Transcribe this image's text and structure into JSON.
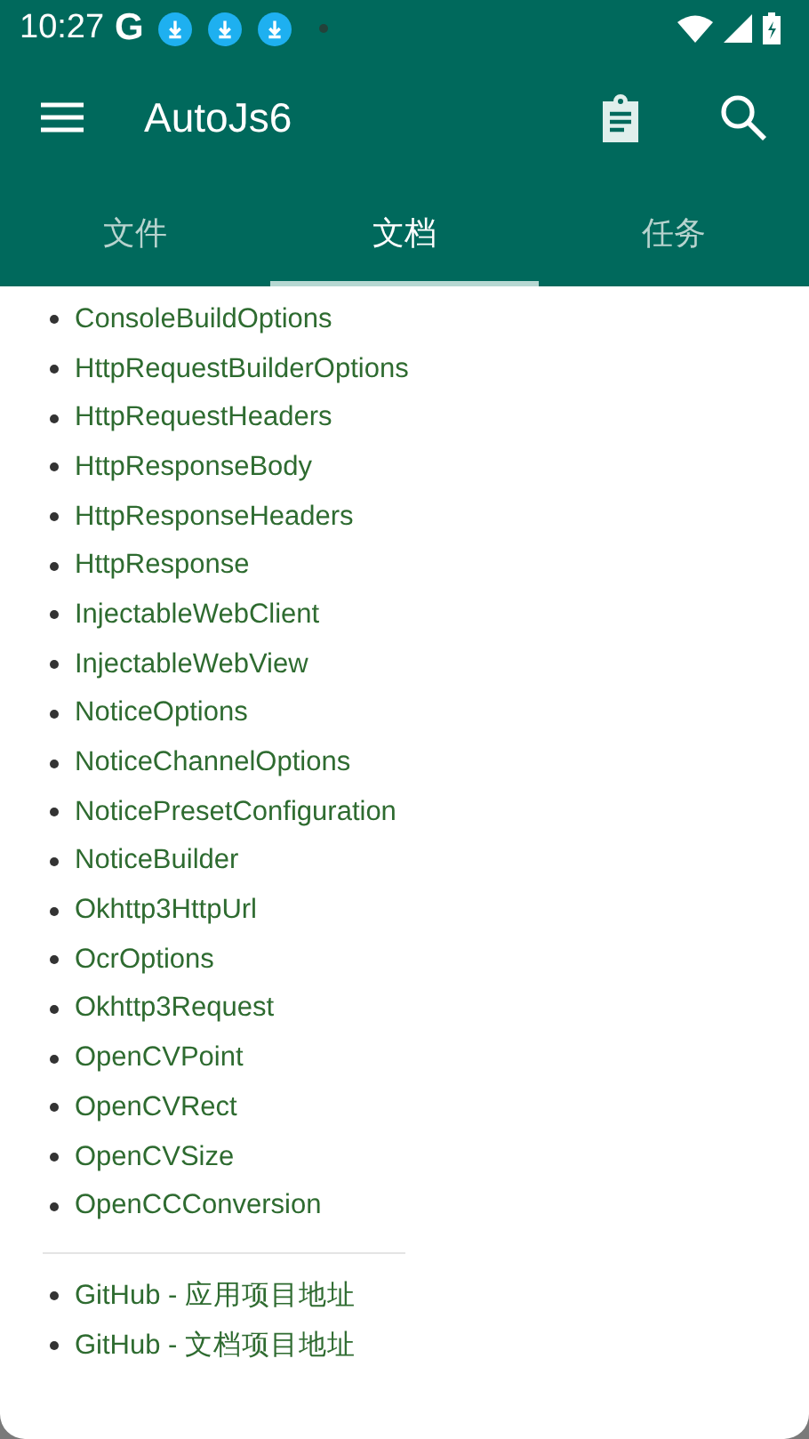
{
  "status_bar": {
    "time": "10:27",
    "carrier_letter": "G"
  },
  "app_bar": {
    "title": "AutoJs6"
  },
  "tabs": [
    {
      "label": "文件",
      "selected": false
    },
    {
      "label": "文档",
      "selected": true
    },
    {
      "label": "任务",
      "selected": false
    }
  ],
  "doc_links": [
    "ConsoleBuildOptions",
    "HttpRequestBuilderOptions",
    "HttpRequestHeaders",
    "HttpResponseBody",
    "HttpResponseHeaders",
    "HttpResponse",
    "InjectableWebClient",
    "InjectableWebView",
    "NoticeOptions",
    "NoticeChannelOptions",
    "NoticePresetConfiguration",
    "NoticeBuilder",
    "Okhttp3HttpUrl",
    "OcrOptions",
    "Okhttp3Request",
    "OpenCVPoint",
    "OpenCVRect",
    "OpenCVSize",
    "OpenCCConversion"
  ],
  "repo_links": [
    "GitHub - 应用项目地址",
    "GitHub - 文档项目地址"
  ]
}
